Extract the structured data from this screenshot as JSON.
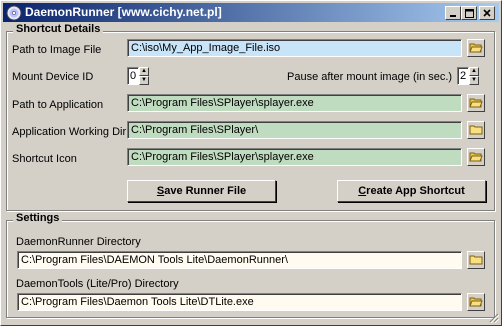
{
  "window": {
    "title": "DaemonRunner   [www.cichy.net.pl]",
    "title_color": "#0a246a"
  },
  "shortcut_details": {
    "group_title": "Shortcut Details",
    "image_file": {
      "label": "Path to Image File",
      "value": "C:\\iso\\My_App_Image_File.iso"
    },
    "mount_device": {
      "label": "Mount Device ID",
      "value": "0"
    },
    "pause": {
      "label": "Pause after mount image (in sec.)",
      "value": "2"
    },
    "application": {
      "label": "Path to Application",
      "value": "C:\\Program Files\\SPlayer\\splayer.exe"
    },
    "working_dir": {
      "label": "Application Working Dir",
      "value": "C:\\Program Files\\SPlayer\\"
    },
    "icon": {
      "label": "Shortcut Icon",
      "value": "C:\\Program Files\\SPlayer\\splayer.exe"
    },
    "save_button": {
      "prefix": "S",
      "rest": "ave Runner File"
    },
    "create_button": {
      "prefix": "C",
      "rest": "reate App Shortcut"
    }
  },
  "settings": {
    "group_title": "Settings",
    "runner_dir": {
      "label": "DaemonRunner Directory",
      "value": "C:\\Program Files\\DAEMON Tools Lite\\DaemonRunner\\"
    },
    "tools_dir": {
      "label": "DaemonTools (Lite/Pro) Directory",
      "value": "C:\\Program Files\\Daemon Tools Lite\\DTLite.exe"
    }
  },
  "colors": {
    "field_green": "#c0dcc0",
    "field_blue": "#c8e4f8",
    "field_ivory": "#fffbf0"
  },
  "icons": [
    "app-disc-icon",
    "minimize-icon",
    "maximize-icon",
    "close-icon",
    "folder-open-icon",
    "folder-icon",
    "spin-up-icon",
    "spin-down-icon",
    "size-grip-icon"
  ]
}
